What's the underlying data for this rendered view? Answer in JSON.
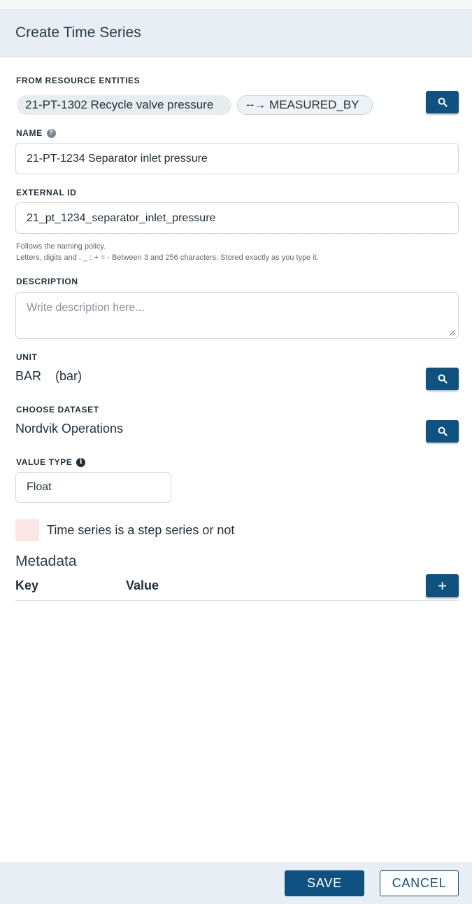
{
  "dialog": {
    "title": "Create Time Series"
  },
  "resource_entities": {
    "label": "FROM RESOURCE ENTITIES",
    "entity": "21-PT-1302 Recycle valve pressure",
    "relation": "--→ MEASURED_BY"
  },
  "name": {
    "label": "NAME",
    "value": "21-PT-1234 Separator inlet pressure"
  },
  "external_id": {
    "label": "EXTERNAL ID",
    "value": "21_pt_1234_separator_inlet_pressure",
    "help_line1": "Follows the naming policy.",
    "help_line2": "Letters, digits and . _ : + = - Between 3 and 256 characters. Stored exactly as you type it."
  },
  "description": {
    "label": "DESCRIPTION",
    "placeholder": "Write description here..."
  },
  "unit": {
    "label": "UNIT",
    "value": "BAR    (bar)"
  },
  "dataset": {
    "label": "CHOOSE DATASET",
    "value": "Nordvik Operations"
  },
  "value_type": {
    "label": "VALUE TYPE",
    "value": "Float"
  },
  "step_series": {
    "label": "Time series is a step series or not",
    "checked": false
  },
  "metadata": {
    "title": "Metadata",
    "key_header": "Key",
    "value_header": "Value",
    "add_label": "+"
  },
  "footer": {
    "save_label": "SAVE",
    "cancel_label": "CANCEL"
  },
  "colors": {
    "primary": "#0f5281",
    "header_bg": "#e8eef3",
    "checkbox_bg": "#fde5e5"
  },
  "icons": {
    "search": "search-icon",
    "help": "question-icon",
    "info": "info-icon",
    "resize": "resize-grip-icon"
  }
}
